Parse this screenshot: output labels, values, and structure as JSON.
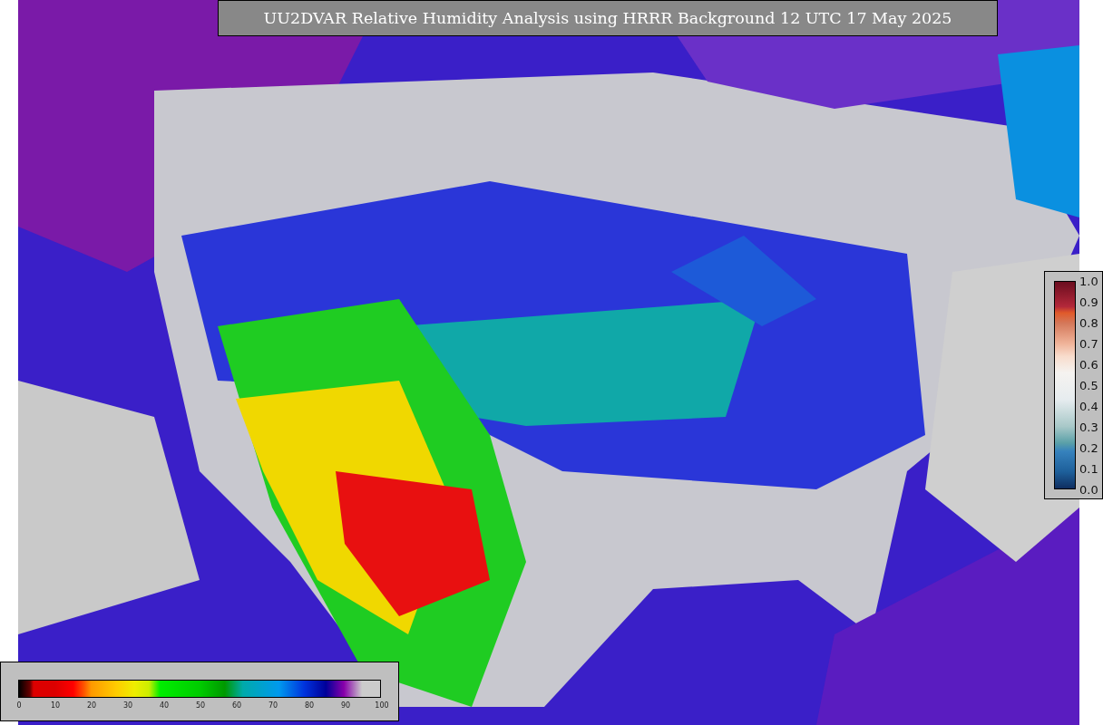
{
  "title": "UU2DVAR Relative Humidity Analysis using HRRR Background 12 UTC 17 May 2025",
  "humidity_colorbar": {
    "ticks": [
      "0",
      "10",
      "20",
      "30",
      "40",
      "50",
      "60",
      "70",
      "80",
      "90",
      "100"
    ]
  },
  "observation_colorbar": {
    "ticks": [
      "1.0",
      "0.9",
      "0.8",
      "0.7",
      "0.6",
      "0.5",
      "0.4",
      "0.3",
      "0.2",
      "0.1",
      "0.0"
    ]
  }
}
